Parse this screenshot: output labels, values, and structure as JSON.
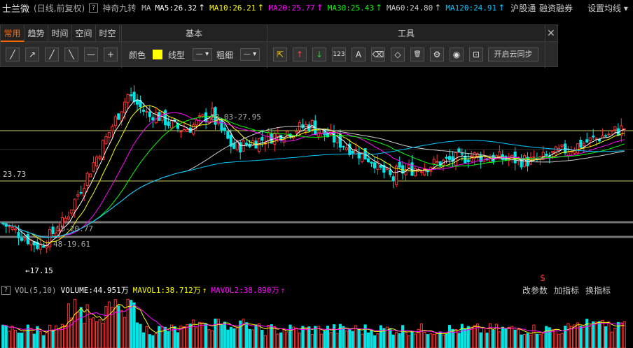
{
  "header": {
    "stock_name": "士兰微",
    "period": "(日线,前复权)",
    "indicator": "神奇九转",
    "ma_label": "MA",
    "ma": [
      {
        "label": "MA5:26.32",
        "color": "#ffffff"
      },
      {
        "label": "MA10:26.21",
        "color": "#ffff00"
      },
      {
        "label": "MA20:25.77",
        "color": "#ff00ff"
      },
      {
        "label": "MA30:25.43",
        "color": "#00ff00"
      },
      {
        "label": "MA60:24.80",
        "color": "#cccccc"
      },
      {
        "label": "MA120:24.91",
        "color": "#00c8ff"
      }
    ],
    "up_arrow": "↑",
    "link1": "沪股通",
    "link2": "融资融券",
    "link3": "设置均线 ▾"
  },
  "toolbar": {
    "tabs": [
      "常用",
      "趋势",
      "时间",
      "空间",
      "时空"
    ],
    "section_basic": "基本",
    "section_tools": "工具",
    "close": "✕",
    "draw_tools": [
      "╱",
      "↗",
      "╱",
      "╲",
      "—",
      "+"
    ],
    "color_label": "颜色",
    "line_type_label": "线型",
    "line_type_value": "— ▾",
    "thickness_label": "粗细",
    "thickness_value": "— ▾",
    "tool_icons": [
      "⇱",
      "↑",
      "↓",
      "123",
      "A",
      "⌫",
      "◇",
      "🗑",
      "⚙",
      "◉",
      "⊡"
    ],
    "sync_label": "开启云同步"
  },
  "chart": {
    "price_line_label": "23.73",
    "annotations": {
      "high": "28.03-27.95",
      "low_a": "55-20.77",
      "low_b": "48-19.61",
      "min": "←17.15",
      "marker": "$"
    },
    "colors": {
      "up": "#ff3232",
      "down": "#00e6e6",
      "ma5": "#ffffff",
      "ma10": "#ffff00",
      "ma20": "#ff00ff",
      "ma30": "#00ff00",
      "ma60": "#cccccc",
      "ma120": "#00c8ff"
    }
  },
  "volume": {
    "label": "VOL(5,10)",
    "volume": "VOLUME:44.951万",
    "mavol1": "MAVOL1:38.712万",
    "mavol2": "MAVOL2:38.890万",
    "up_arrow": "↑",
    "link1": "改参数",
    "link2": "加指标",
    "link3": "换指标"
  }
}
